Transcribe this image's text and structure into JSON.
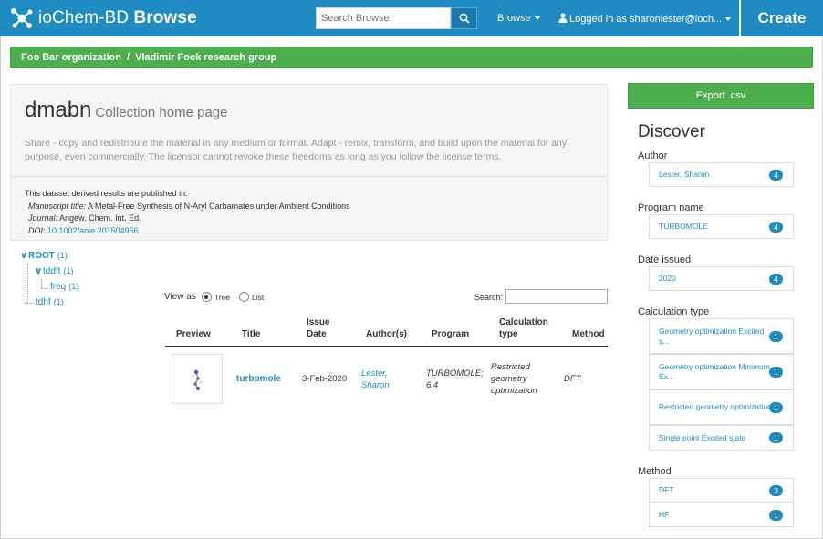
{
  "navbar": {
    "brand_prefix": "ioChem-BD",
    "brand_suffix": "Browse",
    "search_placeholder": "Search Browse",
    "browse_label": "Browse",
    "user_label": "Logged in as sharonlester@ioch...",
    "create_label": "Create",
    "colors": {
      "bar": "#1e8bc3",
      "accent_green": "#4cae4c"
    }
  },
  "breadcrumb": {
    "items": [
      "Foo Bar organization",
      "Vladimir Fock research group"
    ],
    "separator": "/"
  },
  "collection": {
    "name": "dmabn",
    "subtitle": "Collection home page",
    "license": "Share - copy and redistribute the material in any medium or format. Adapt - remix, transform, and build upon the material for any purpose, even commercially. The licensor cannot revoke these freedoms as long as you follow the license terms.",
    "publication": {
      "intro": "This dataset derived results are published in:",
      "manuscript_label": "Manuscript title:",
      "manuscript_value": "A Metal-Free Synthesis of N-Aryl Carbamates under Ambient Conditions",
      "journal_label": "Journal:",
      "journal_value": "Angew. Chem. Int. Ed.",
      "doi_label": "DOI:",
      "doi_value": "10.1002/anie.201504956"
    }
  },
  "tree": [
    {
      "label": "ROOT",
      "count": "(1)"
    },
    {
      "label": "tddft",
      "count": "(1)"
    },
    {
      "label": "freq",
      "count": "(1)"
    },
    {
      "label": "tdhf",
      "count": "(1)"
    }
  ],
  "view": {
    "label": "View as",
    "options": [
      "Tree",
      "List"
    ],
    "selected": "Tree",
    "search_label": "Search:",
    "search_value": ""
  },
  "table": {
    "headers": {
      "preview": "Preview",
      "title": "Title",
      "issue_date": "Issue Date",
      "authors": "Author(s)",
      "program": "Program",
      "calc_type": "Calculation type",
      "method": "Method"
    },
    "rows": [
      {
        "title": "turbomole",
        "issue_date": "3-Feb-2020",
        "authors": "Lester, Sharon",
        "program": "TURBOMOLE; 6.4",
        "calc_type": "Restricted geometry optimization",
        "method": "DFT"
      }
    ]
  },
  "sidebar": {
    "export_label": "Export .csv",
    "discover_title": "Discover",
    "facets": {
      "author": {
        "label": "Author",
        "items": [
          {
            "name": "Lester, Sharon",
            "count": "4"
          }
        ]
      },
      "program": {
        "label": "Program name",
        "items": [
          {
            "name": "TURBOMOLE",
            "count": "4"
          }
        ]
      },
      "date": {
        "label": "Date issued",
        "items": [
          {
            "name": "2020",
            "count": "4"
          }
        ]
      },
      "calc": {
        "label": "Calculation type",
        "items": [
          {
            "name": "Geometry optimization Excited s...",
            "count": "1"
          },
          {
            "name": "Geometry optimization Minimum Ex...",
            "count": "1"
          },
          {
            "name": "Restricted geometry optimization",
            "count": "1"
          },
          {
            "name": "Single point Excited state",
            "count": "1"
          }
        ]
      },
      "method": {
        "label": "Method",
        "items": [
          {
            "name": "DFT",
            "count": "3"
          },
          {
            "name": "HF",
            "count": "1"
          }
        ]
      }
    }
  }
}
